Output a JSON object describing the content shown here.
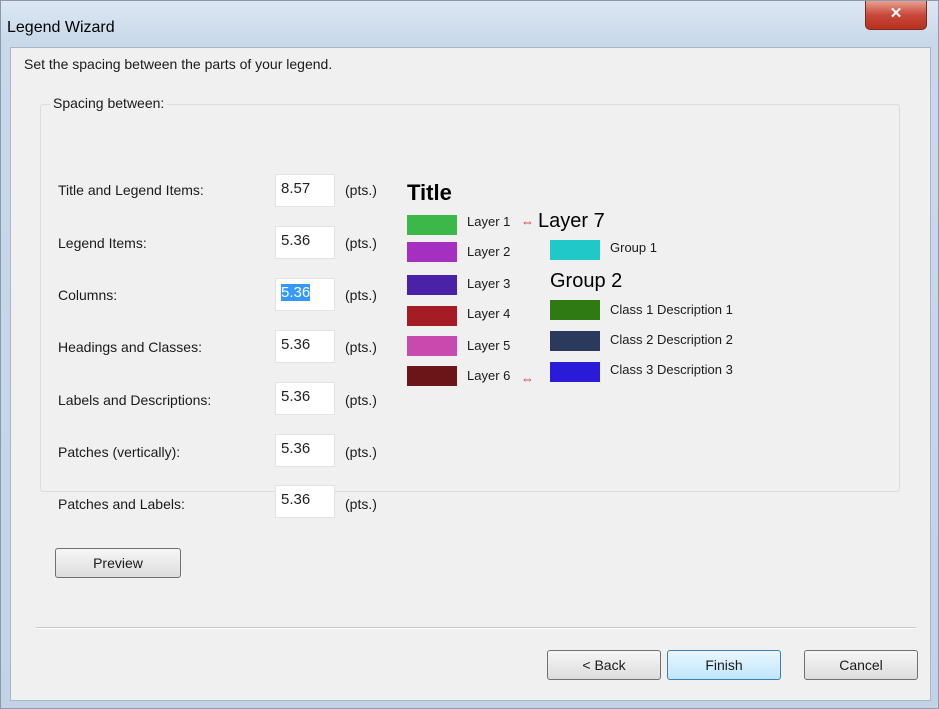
{
  "window": {
    "title": "Legend Wizard",
    "close_symbol": "✕"
  },
  "instruction": "Set the spacing between the parts of your legend.",
  "group": {
    "label": "Spacing between:"
  },
  "rows": [
    {
      "label": "Title and Legend Items:",
      "value": "8.57",
      "unit": "(pts.)"
    },
    {
      "label": "Legend Items:",
      "value": "5.36",
      "unit": "(pts.)"
    },
    {
      "label": "Columns:",
      "value": "5.36",
      "unit": "(pts.)"
    },
    {
      "label": "Headings and Classes:",
      "value": "5.36",
      "unit": "(pts.)"
    },
    {
      "label": "Labels and Descriptions:",
      "value": "5.36",
      "unit": "(pts.)"
    },
    {
      "label": "Patches (vertically):",
      "value": "5.36",
      "unit": "(pts.)"
    },
    {
      "label": "Patches and Labels:",
      "value": "5.36",
      "unit": "(pts.)"
    }
  ],
  "preview": {
    "title": "Title",
    "layers": [
      {
        "label": "Layer 1",
        "color": "#3cb84a"
      },
      {
        "label": "Layer 2",
        "color": "#a52fc0"
      },
      {
        "label": "Layer 3",
        "color": "#4a22a8"
      },
      {
        "label": "Layer 4",
        "color": "#a51c24"
      },
      {
        "label": "Layer 5",
        "color": "#c94aae"
      },
      {
        "label": "Layer 6",
        "color": "#6c1518"
      }
    ],
    "spacing_arrow": "⇔",
    "layer7_heading": "Layer 7",
    "group1": {
      "label": "Group 1",
      "color": "#20c8c8"
    },
    "group2_heading": "Group 2",
    "classes": [
      {
        "label": "Class 1 Description 1",
        "color": "#2f7a12"
      },
      {
        "label": "Class 2 Description 2",
        "color": "#2b3a5c"
      },
      {
        "label": "Class 3 Description 3",
        "color": "#2a1bd8"
      }
    ]
  },
  "buttons": {
    "preview": "Preview",
    "back": "< Back",
    "finish": "Finish",
    "cancel": "Cancel"
  }
}
